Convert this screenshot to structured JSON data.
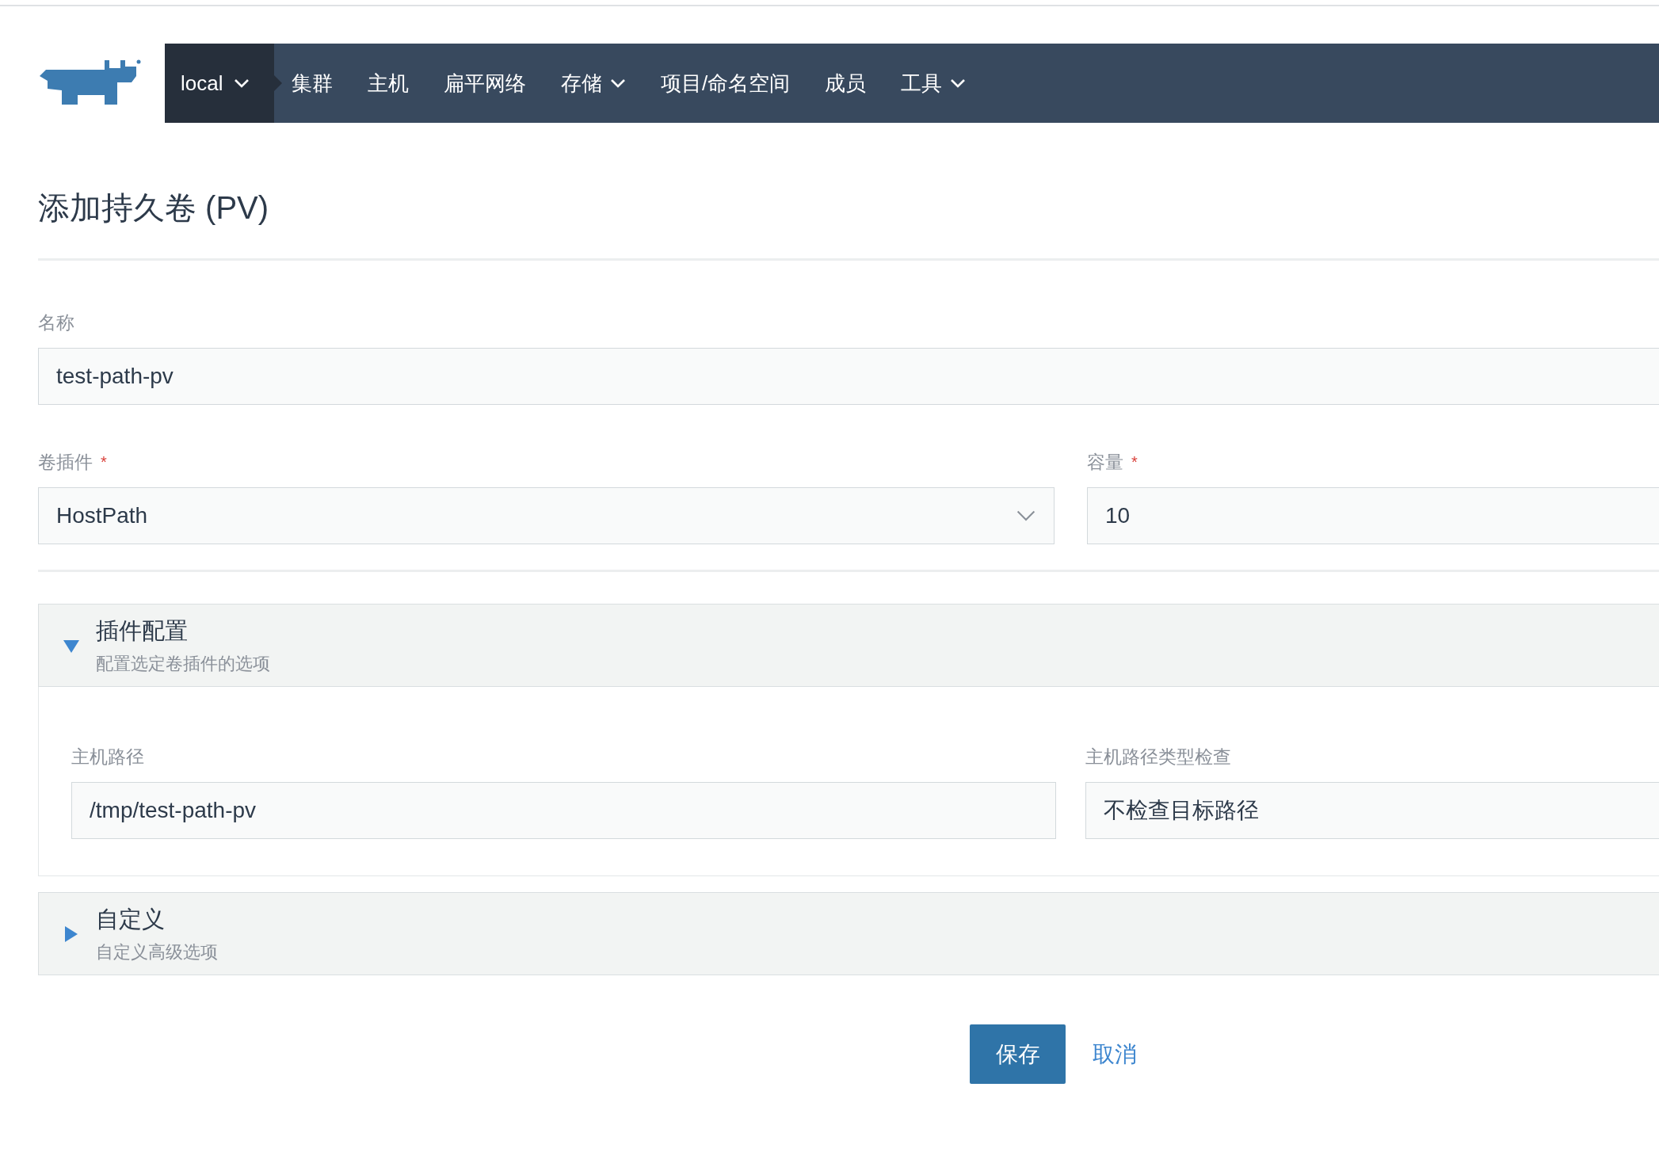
{
  "nav": {
    "cluster": {
      "label": "local"
    },
    "items": [
      {
        "label": "集群",
        "dropdown": false
      },
      {
        "label": "主机",
        "dropdown": false
      },
      {
        "label": "扁平网络",
        "dropdown": false
      },
      {
        "label": "存储",
        "dropdown": true
      },
      {
        "label": "项目/命名空间",
        "dropdown": false
      },
      {
        "label": "成员",
        "dropdown": false
      },
      {
        "label": "工具",
        "dropdown": true
      }
    ]
  },
  "page_title": "添加持久卷 (PV)",
  "name_field": {
    "label": "名称",
    "kind": "text",
    "value": "test-path-pv"
  },
  "row_fields": [
    {
      "label": "卷插件",
      "required_mark": "*",
      "kind": "select",
      "value": "HostPath"
    },
    {
      "label": "容量",
      "required_mark": "*",
      "kind": "text",
      "value": "10"
    }
  ],
  "sections": [
    {
      "title": "插件配置",
      "subtitle": "配置选定卷插件的选项",
      "expanded": true,
      "fields": [
        {
          "label": "主机路径",
          "kind": "text",
          "value": "/tmp/test-path-pv"
        },
        {
          "label": "主机路径类型检查",
          "kind": "text",
          "value": "不检查目标路径"
        }
      ]
    },
    {
      "title": "自定义",
      "subtitle": "自定义高级选项",
      "expanded": false
    }
  ],
  "actions": [
    {
      "label": "保存",
      "kind": "primary"
    },
    {
      "label": "取消",
      "kind": "link"
    }
  ]
}
